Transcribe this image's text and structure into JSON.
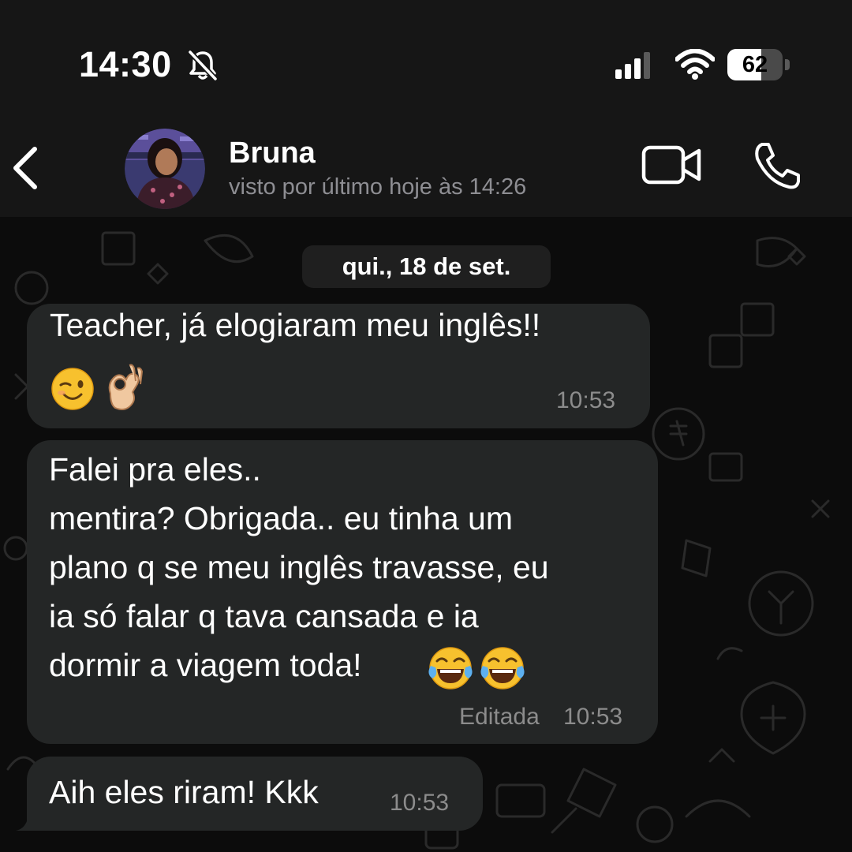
{
  "status_bar": {
    "time": "14:30",
    "battery_percent": "62",
    "battery_level": 0.62,
    "icons": [
      "bell-slash-icon",
      "signal-icon",
      "wifi-icon",
      "battery-icon"
    ]
  },
  "header": {
    "back_icon": "chevron-left-icon",
    "contact_name": "Bruna",
    "last_seen": "visto por último hoje às 14:26",
    "video_icon": "video-camera-icon",
    "call_icon": "phone-icon"
  },
  "chat": {
    "date_separator": "qui., 18 de set.",
    "messages": [
      {
        "text": "Teacher, já elogiaram meu inglês!!",
        "emojis": [
          "winking-face-emoji",
          "ok-hand-emoji"
        ],
        "time": "10:53",
        "edited_label": ""
      },
      {
        "lines": [
          "Falei pra eles..",
          "mentira? Obrigada.. eu tinha um",
          "plano q se meu inglês travasse, eu",
          "ia só falar q tava cansada e ia",
          "dormir a viagem toda!"
        ],
        "emojis": [
          "tears-of-joy-emoji",
          "tears-of-joy-emoji"
        ],
        "time": "10:53",
        "edited_label": "Editada"
      },
      {
        "text": "Aih eles riram! Kkk",
        "time": "10:53",
        "edited_label": ""
      }
    ]
  },
  "colors": {
    "background": "#0b0b0b",
    "header": "#161616",
    "bubble": "#242626",
    "secondary_text": "#8e8e93"
  }
}
